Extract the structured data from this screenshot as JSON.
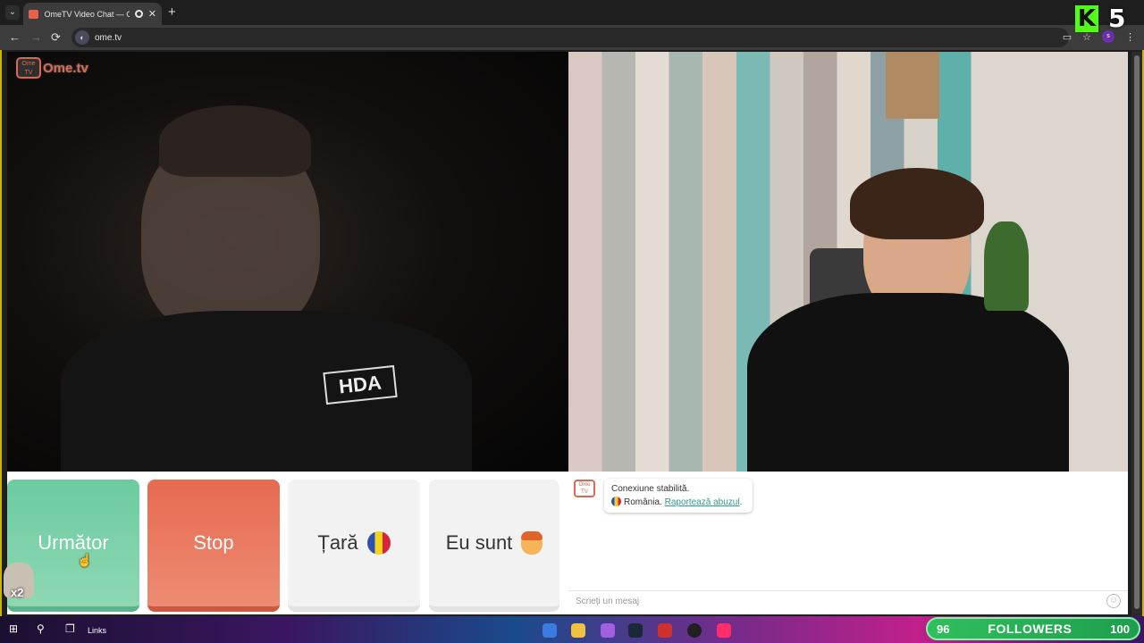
{
  "browser": {
    "tab_title": "OmeTV Video Chat — Ome",
    "url": "ome.tv",
    "new_tab": "+",
    "tab_close": "✕",
    "back": "←",
    "forward": "→",
    "reload": "⟳"
  },
  "overlay": {
    "kick_letter": "K",
    "kick_count": "5",
    "followers_left": "96",
    "followers_label": "FOLLOWERS",
    "followers_right": "100",
    "multiplier": "x2"
  },
  "brand": {
    "logo_icon_text": "Ome TV",
    "logo_text": "Ome.tv",
    "accent": "#d86a54"
  },
  "video": {
    "left_shirt_text": "HDA"
  },
  "buttons": {
    "next_label": "Următor",
    "stop_label": "Stop",
    "country_label": "Țară",
    "gender_label": "Eu sunt"
  },
  "colors": {
    "next": "#6ccba0",
    "stop": "#e66a50",
    "kick": "#53fc18",
    "followers": "#2fbf5e"
  },
  "chat": {
    "avatar_text": "Ome TV",
    "connection_text": "Conexiune stabilită.",
    "country": "România.",
    "report_link": "Raportează abuzul",
    "report_suffix": ".",
    "input_placeholder": "Scrieți un mesaj"
  },
  "taskbar": {
    "links": "Links"
  }
}
